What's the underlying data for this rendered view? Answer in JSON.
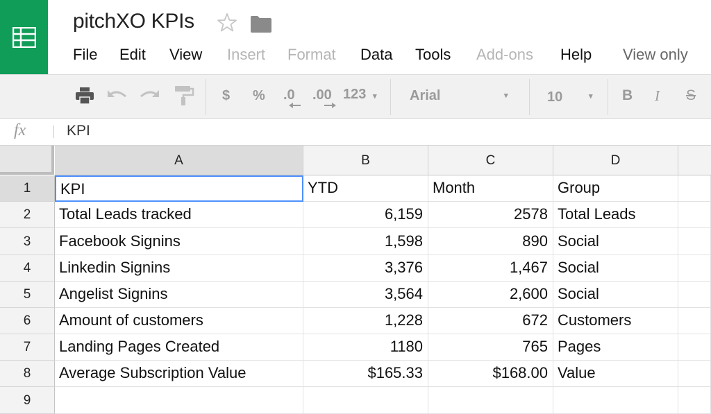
{
  "app": {
    "title": "pitchXO KPIs",
    "icons": [
      "sheets-logo-icon",
      "star-icon",
      "folder-icon"
    ],
    "accent_color": "#0f9d58"
  },
  "menu": [
    {
      "label": "File",
      "enabled": true
    },
    {
      "label": "Edit",
      "enabled": true
    },
    {
      "label": "View",
      "enabled": true
    },
    {
      "label": "Insert",
      "enabled": false
    },
    {
      "label": "Format",
      "enabled": false
    },
    {
      "label": "Data",
      "enabled": true
    },
    {
      "label": "Tools",
      "enabled": true
    },
    {
      "label": "Add-ons",
      "enabled": false
    },
    {
      "label": "Help",
      "enabled": true
    }
  ],
  "mode_label": "View only",
  "toolbar": {
    "currency": "$",
    "percent": "%",
    "decrease_decimals": ".0",
    "increase_decimals": ".00",
    "number_format": "123",
    "font_name": "Arial",
    "font_size": "10",
    "bold": "B",
    "italic": "I",
    "strike": "S"
  },
  "formula_bar": {
    "label": "fx",
    "value": "KPI"
  },
  "sheet": {
    "columns": [
      "A",
      "B",
      "C",
      "D"
    ],
    "row_numbers": [
      "1",
      "2",
      "3",
      "4",
      "5",
      "6",
      "7",
      "8",
      "9"
    ],
    "rows": [
      [
        "KPI",
        "YTD",
        "Month",
        "Group"
      ],
      [
        "Total Leads tracked",
        "6,159",
        "2578",
        "Total Leads"
      ],
      [
        "Facebook Signins",
        "1,598",
        "890",
        "Social"
      ],
      [
        "Linkedin Signins",
        "3,376",
        "1,467",
        "Social"
      ],
      [
        "Angelist Signins",
        "3,564",
        "2,600",
        "Social"
      ],
      [
        "Amount of customers",
        "1,228",
        "672",
        "Customers"
      ],
      [
        "Landing Pages Created",
        "1180",
        "765",
        "Pages"
      ],
      [
        "Average Subscription Value",
        "$165.33",
        "$168.00",
        "Value"
      ],
      [
        "",
        "",
        "",
        ""
      ]
    ],
    "active_cell": "A1"
  }
}
